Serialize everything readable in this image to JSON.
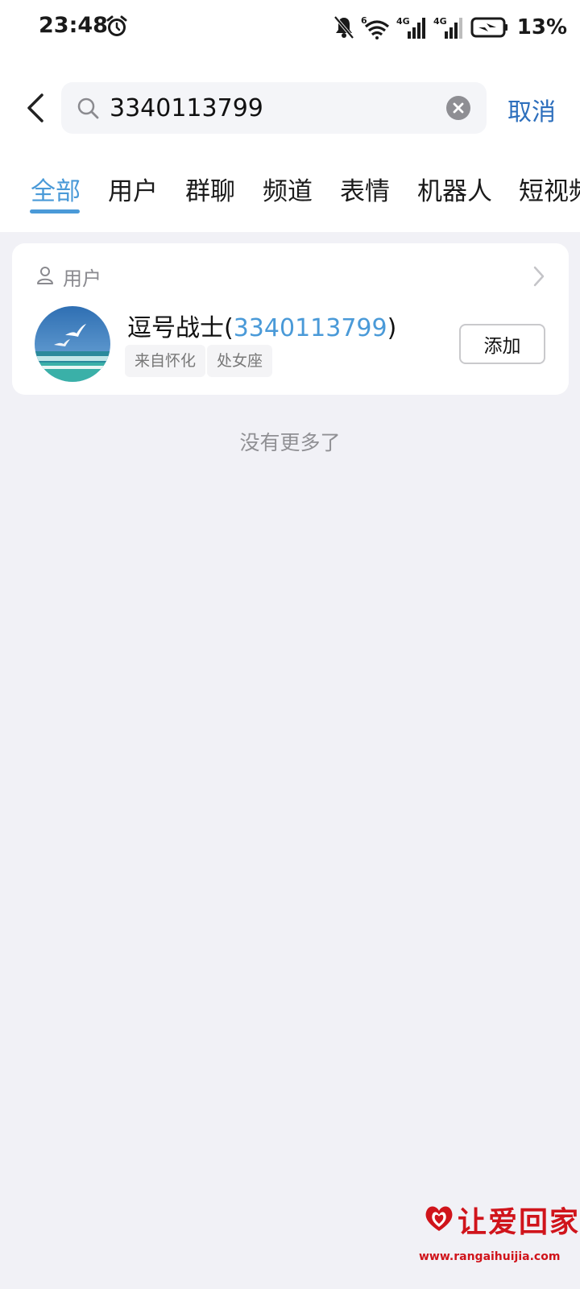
{
  "status_bar": {
    "time": "23:48",
    "battery": "13%",
    "icons": [
      "alarm-icon",
      "bell-off-icon",
      "wifi-6-icon",
      "signal-4g-icon",
      "signal-4g-icon",
      "battery-charging-icon"
    ],
    "signal_label_1": "4G",
    "signal_label_2": "4G",
    "wifi_label": "6"
  },
  "search": {
    "query": "3340113799",
    "cancel_label": "取消"
  },
  "tabs": [
    {
      "label": "全部",
      "active": true
    },
    {
      "label": "用户",
      "active": false
    },
    {
      "label": "群聊",
      "active": false
    },
    {
      "label": "频道",
      "active": false
    },
    {
      "label": "表情",
      "active": false
    },
    {
      "label": "机器人",
      "active": false
    },
    {
      "label": "短视频",
      "active": false
    }
  ],
  "results": {
    "section_title": "用户",
    "user": {
      "name": "逗号战士",
      "open_paren": "(",
      "id": "3340113799",
      "close_paren": ")",
      "tags": [
        "来自怀化",
        "处女座"
      ],
      "add_label": "添加"
    },
    "no_more": "没有更多了"
  },
  "watermark": {
    "text": "让爱回家",
    "url": "www.rangaihuijia.com"
  },
  "colors": {
    "accent": "#4a9ad8",
    "cancel": "#2d6fbd",
    "background": "#f1f1f6",
    "watermark": "#d0141b"
  }
}
